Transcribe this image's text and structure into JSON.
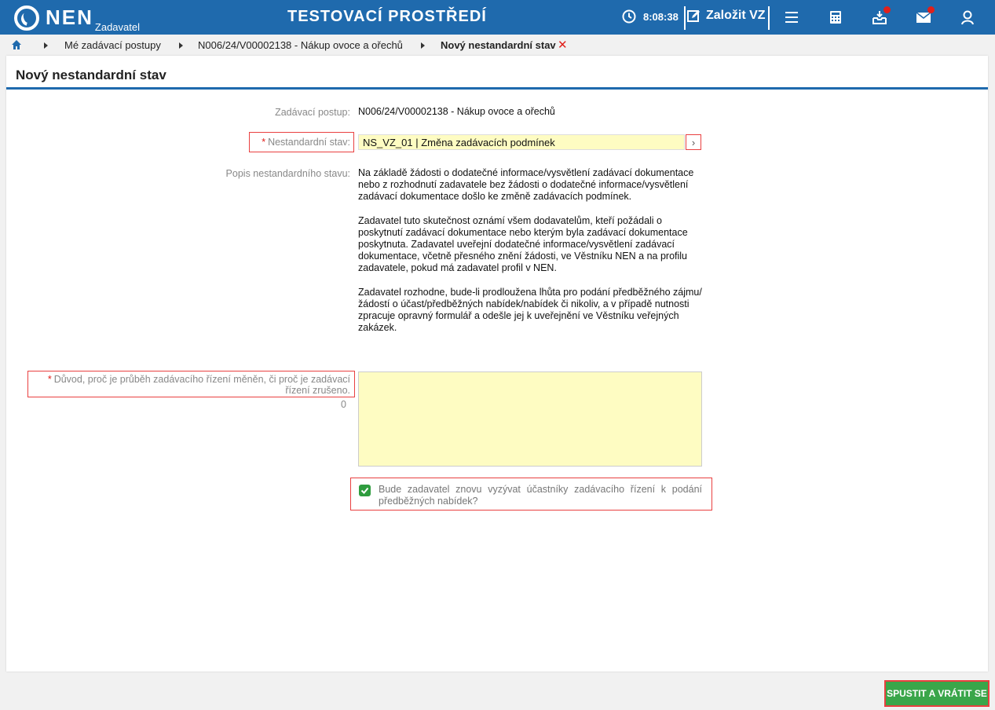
{
  "header": {
    "logo_text": "NEN",
    "logo_sub": "Zadavatel",
    "environment": "TESTOVACÍ PROSTŘEDÍ",
    "time": "8:08:38",
    "create_label": "Založit VZ",
    "icons": [
      "clock-icon",
      "edit-icon",
      "menu-icon",
      "calculator-icon",
      "inbox-icon",
      "mail-icon",
      "user-icon"
    ]
  },
  "breadcrumb": {
    "items": [
      "Mé zadávací postupy",
      "N006/24/V00002138 - Nákup ovoce a ořechů",
      "Nový nestandardní stav"
    ],
    "close": "✕"
  },
  "page": {
    "title": "Nový nestandardní stav"
  },
  "form": {
    "zadavaci_postup_label": "Zadávací postup:",
    "zadavaci_postup_value": "N006/24/V00002138 - Nákup ovoce a ořechů",
    "nestandardni_stav_label": "Nestandardní stav:",
    "nestandardni_stav_value": "NS_VZ_01 | Změna zadávacích podmínek",
    "popis_label": "Popis nestandardního stavu:",
    "popis_paragraphs": [
      "Na základě žádosti o dodatečné informace/vysvětlení zadávací dokumentace nebo z rozhodnutí zadavatele bez žádosti o dodatečné informace/vysvětlení zadávací dokumentace došlo ke změně zadávacích podmínek.",
      "Zadavatel tuto skutečnost oznámí všem dodavatelům, kteří požádali o poskytnutí zadávací dokumentace nebo kterým byla zadávací dokumentace poskytnuta. Zadavatel uveřejní dodatečné informace/vysvětlení zadávací dokumentace, včetně přesného znění žádosti, ve Věstníku NEN a na profilu zadavatele, pokud má zadavatel profil v NEN.",
      "Zadavatel rozhodne, bude-li prodloužena lhůta pro podání předběžného zájmu/žádostí o účast/předběžných nabídek/nabídek či nikoliv, a v případě nutnosti zpracuje opravný formulář a odešle jej k uveřejnění ve Věstníku veřejných zakázek."
    ],
    "duvod_label": "Důvod, proč je průběh zadávacího řízení měněn, či proč je zadávací řízení zrušeno.",
    "duvod_count": "0",
    "duvod_value": "",
    "checkbox_label": "Bude zadavatel znovu vyzývat účastníky zadávacího řízení k podání předběžných nabídek?",
    "checkbox_checked": true
  },
  "footer": {
    "primary_button": "SPUSTIT A VRÁTIT SE"
  },
  "colors": {
    "brand": "#1f6aad",
    "field_bg": "#fefcc2",
    "required": "#e0201b",
    "success": "#3aa64a"
  }
}
